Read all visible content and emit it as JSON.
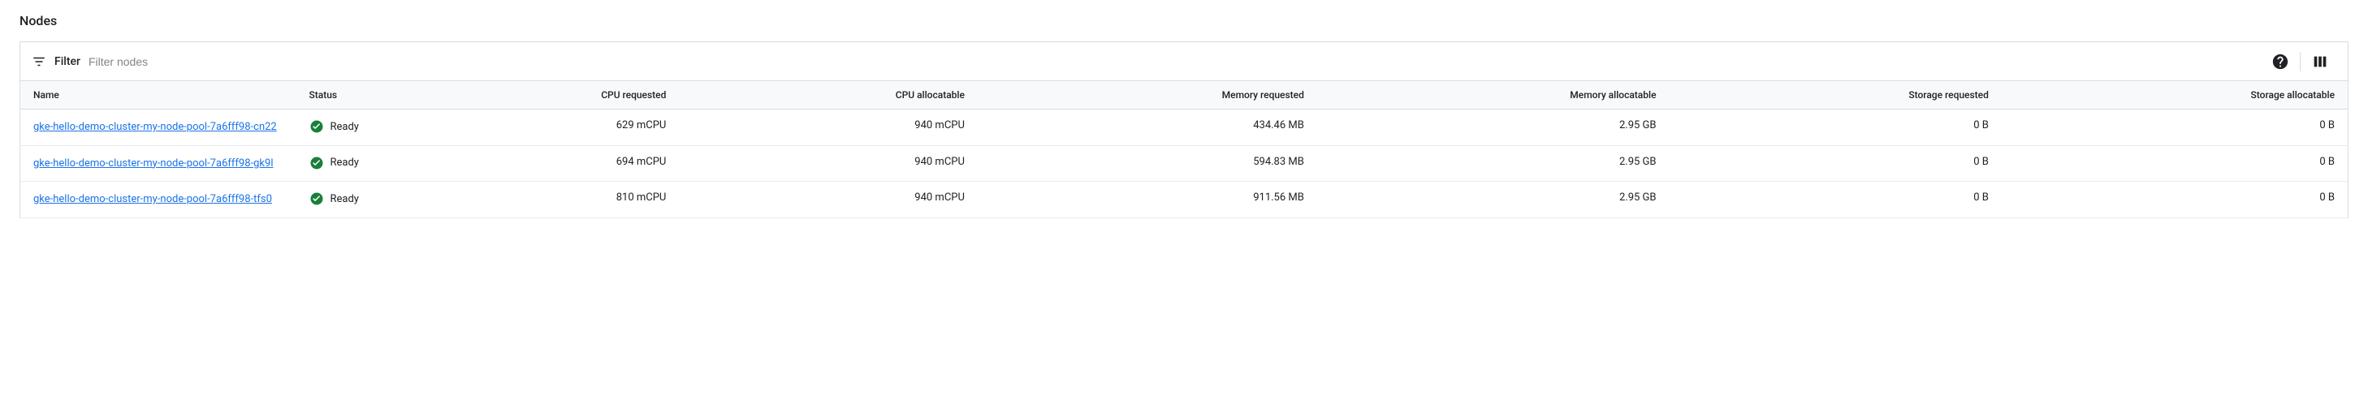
{
  "title": "Nodes",
  "filter": {
    "label": "Filter",
    "placeholder": "Filter nodes"
  },
  "columns": {
    "name": "Name",
    "status": "Status",
    "cpu_requested": "CPU requested",
    "cpu_allocatable": "CPU allocatable",
    "memory_requested": "Memory requested",
    "memory_allocatable": "Memory allocatable",
    "storage_requested": "Storage requested",
    "storage_allocatable": "Storage allocatable"
  },
  "rows": [
    {
      "name": "gke-hello-demo-cluster-my-node-pool-7a6fff98-cn22",
      "status": "Ready",
      "cpu_requested": "629 mCPU",
      "cpu_allocatable": "940 mCPU",
      "memory_requested": "434.46 MB",
      "memory_allocatable": "2.95 GB",
      "storage_requested": "0 B",
      "storage_allocatable": "0 B"
    },
    {
      "name": "gke-hello-demo-cluster-my-node-pool-7a6fff98-gk9l",
      "status": "Ready",
      "cpu_requested": "694 mCPU",
      "cpu_allocatable": "940 mCPU",
      "memory_requested": "594.83 MB",
      "memory_allocatable": "2.95 GB",
      "storage_requested": "0 B",
      "storage_allocatable": "0 B"
    },
    {
      "name": "gke-hello-demo-cluster-my-node-pool-7a6fff98-tfs0",
      "status": "Ready",
      "cpu_requested": "810 mCPU",
      "cpu_allocatable": "940 mCPU",
      "memory_requested": "911.56 MB",
      "memory_allocatable": "2.95 GB",
      "storage_requested": "0 B",
      "storage_allocatable": "0 B"
    }
  ]
}
